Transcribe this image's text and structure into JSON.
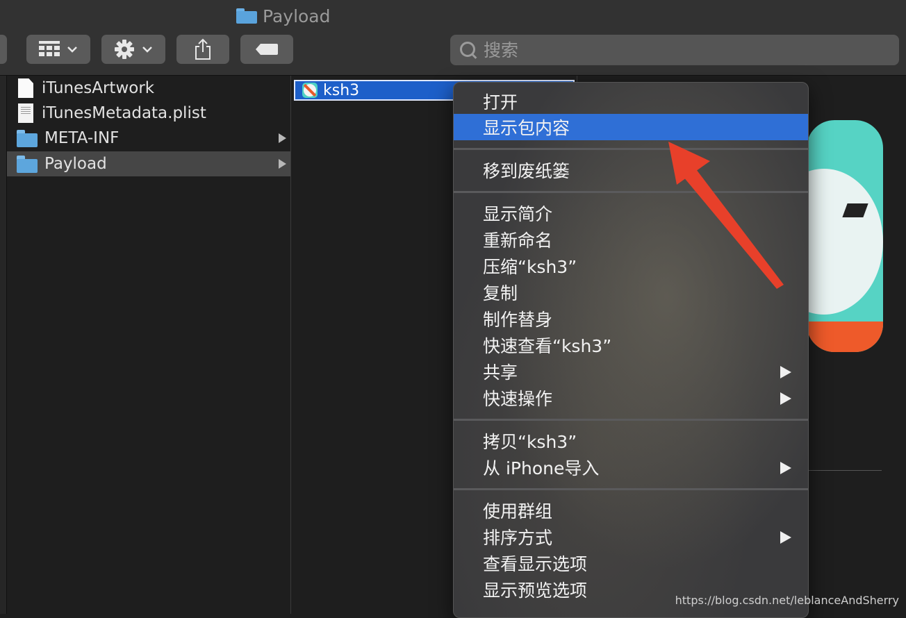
{
  "window": {
    "title": "Payload"
  },
  "toolbar": {
    "view_icon": "grid-view-icon",
    "action_icon": "gear-icon",
    "share_icon": "share-icon",
    "tag_icon": "tag-icon",
    "search_placeholder": "搜索"
  },
  "column1": {
    "items": [
      {
        "label": "iTunesArtwork",
        "icon": "document-icon"
      },
      {
        "label": "iTunesMetadata.plist",
        "icon": "plist-icon"
      },
      {
        "label": "META-INF",
        "icon": "folder-icon"
      },
      {
        "label": "Payload",
        "icon": "folder-icon"
      }
    ]
  },
  "column2": {
    "selected_item": "ksh3"
  },
  "context_menu": {
    "items": [
      "打开",
      "显示包内容",
      "移到废纸篓",
      "显示简介",
      "重新命名",
      "压缩“ksh3”",
      "复制",
      "制作替身",
      "快速查看“ksh3”",
      "共享",
      "快速操作",
      "拷贝“ksh3”",
      "从 iPhone导入",
      "使用群组",
      "排序方式",
      "查看显示选项",
      "显示预览选项"
    ]
  },
  "watermark": "https://blog.csdn.net/leblanceAndSherry",
  "colors": {
    "highlight": "#2f6fd6",
    "annotation_arrow": "#e8402a"
  }
}
